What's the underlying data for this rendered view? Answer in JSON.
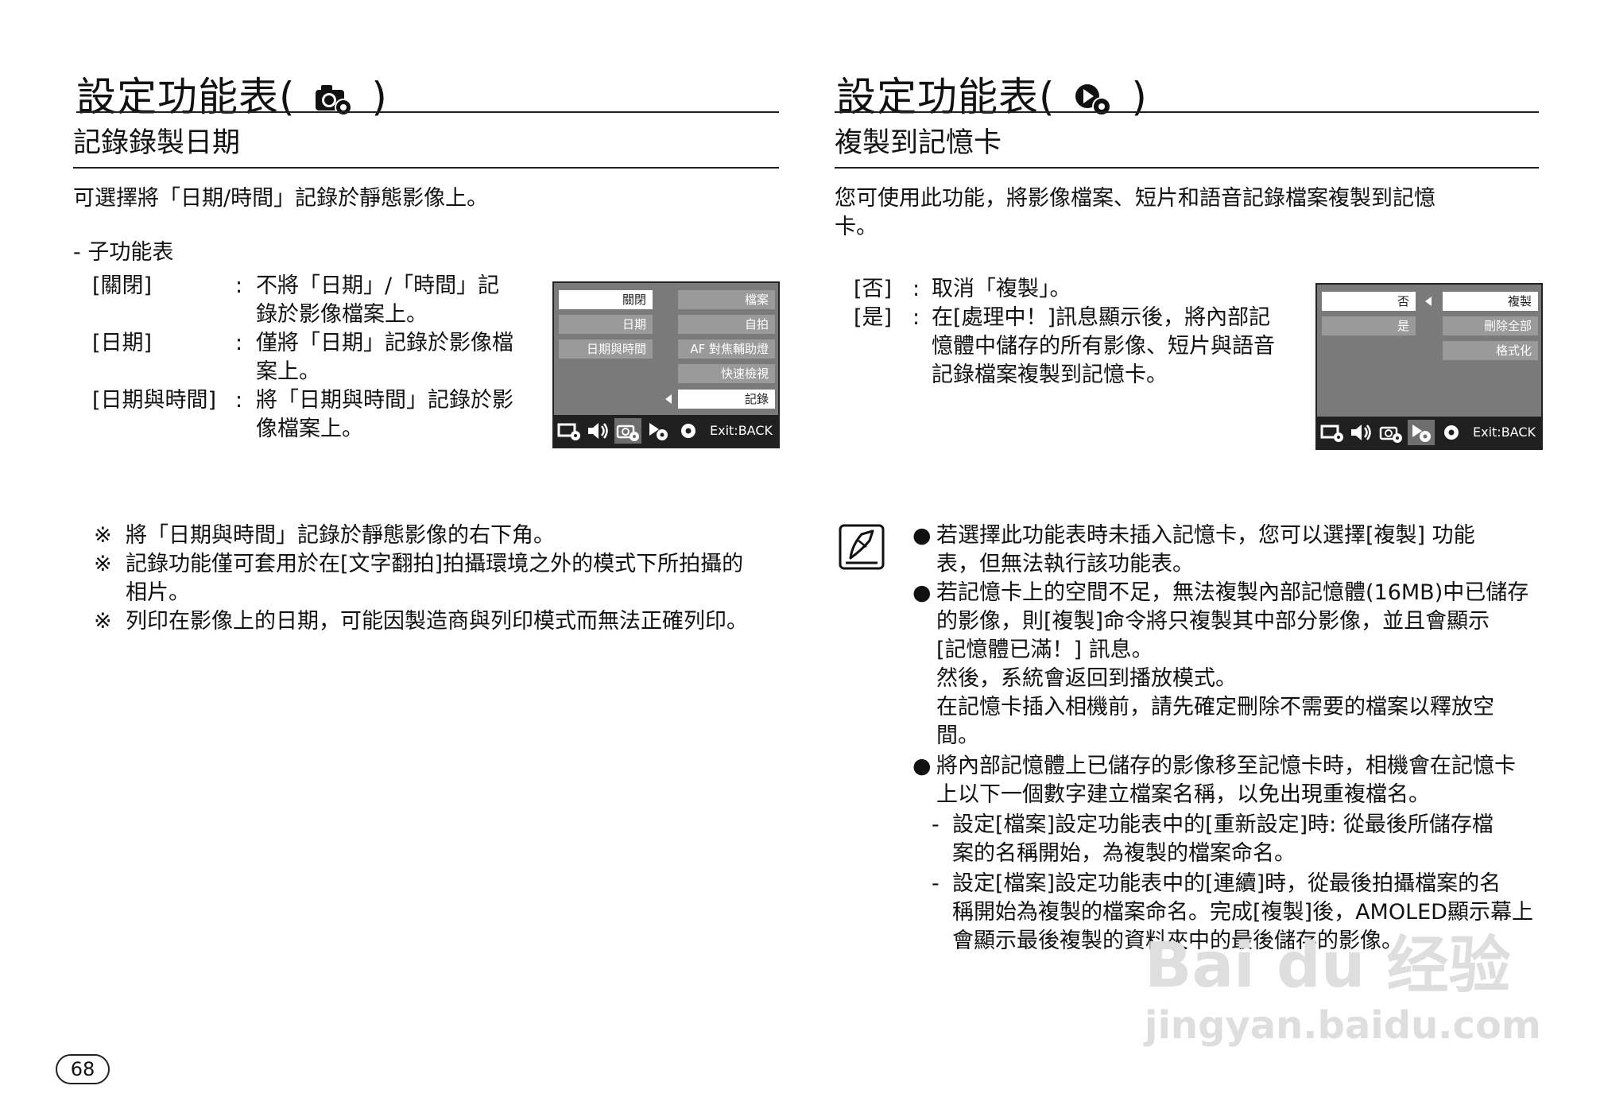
{
  "left": {
    "title_prefix": "設定功能表(",
    "title_suffix": ")",
    "title_icon": "camera-gear-icon",
    "subtitle": "記錄錄製日期",
    "intro": "可選擇將「日期/時間」記錄於靜態影像上。",
    "submenu_heading": "- 子功能表",
    "options": [
      {
        "key": "[關閉]",
        "sep": ":",
        "lines": [
          "不將「日期」/「時間」記",
          "錄於影像檔案上。"
        ]
      },
      {
        "key": "[日期]",
        "sep": ":",
        "lines": [
          "僅將「日期」記錄於影像檔",
          "案上。"
        ]
      },
      {
        "key": "[日期與時間]",
        "sep": ":",
        "lines": [
          "將「日期與時間」記錄於影",
          "像檔案上。"
        ]
      }
    ],
    "screen": {
      "left_items": [
        "關閉",
        "日期",
        "日期與時間"
      ],
      "right_items": [
        "檔案",
        "自拍",
        "AF 對焦輔助燈",
        "快速檢視",
        "記錄"
      ],
      "exit": "Exit:BACK"
    },
    "notes": [
      {
        "mark": "※",
        "lines": [
          "將「日期與時間」記錄於靜態影像的右下角。"
        ]
      },
      {
        "mark": "※",
        "lines": [
          "記錄功能僅可套用於在[文字翻拍]拍攝環境之外的模式下所拍攝的",
          "相片。"
        ]
      },
      {
        "mark": "※",
        "lines": [
          "列印在影像上的日期，可能因製造商與列印模式而無法正確列印。"
        ]
      }
    ]
  },
  "right": {
    "title_prefix": "設定功能表(",
    "title_suffix": ")",
    "title_icon": "playback-gear-icon",
    "subtitle": "複製到記憶卡",
    "intro_lines": [
      "您可使用此功能，將影像檔案、短片和語音記錄檔案複製到記憶",
      "卡。"
    ],
    "options": [
      {
        "key": "[否]",
        "sep": ":",
        "lines": [
          "取消「複製」。"
        ]
      },
      {
        "key": "[是]",
        "sep": ":",
        "lines": [
          "在[處理中！]訊息顯示後，將內部記",
          "憶體中儲存的所有影像、短片與語音",
          "記錄檔案複製到記憶卡。"
        ]
      }
    ],
    "screen": {
      "left_items": [
        "否",
        "是"
      ],
      "right_items": [
        "複製",
        "刪除全部",
        "格式化"
      ],
      "exit": "Exit:BACK"
    },
    "bullets": [
      {
        "mark": "●",
        "lines": [
          "若選擇此功能表時未插入記憶卡，您可以選擇[複製] 功能",
          "表，但無法執行該功能表。"
        ]
      },
      {
        "mark": "●",
        "lines": [
          "若記憶卡上的空間不足，無法複製內部記憶體(16MB)中已儲存",
          "的影像，則[複製]命令將只複製其中部分影像，並且會顯示",
          "[記憶體已滿！] 訊息。",
          "然後，系統會返回到播放模式。",
          "在記憶卡插入相機前，請先確定刪除不需要的檔案以釋放空",
          "間。"
        ]
      },
      {
        "mark": "●",
        "lines": [
          "將內部記憶體上已儲存的影像移至記憶卡時，相機會在記憶卡",
          "上以下一個數字建立檔案名稱，以免出現重複檔名。"
        ]
      }
    ],
    "dashes": [
      {
        "mark": "-",
        "lines": [
          "設定[檔案]設定功能表中的[重新設定]時: 從最後所儲存檔",
          "案的名稱開始，為複製的檔案命名。"
        ]
      },
      {
        "mark": "-",
        "lines": [
          "設定[檔案]設定功能表中的[連續]時，從最後拍攝檔案的名",
          "稱開始為複製的檔案命名。完成[複製]後，AMOLED顯示幕上",
          "會顯示最後複製的資料夾中的最後儲存的影像。"
        ]
      }
    ]
  },
  "page_number": "68",
  "watermark": {
    "brand": "Bai du 经验",
    "url": "jingyan.baidu.com"
  }
}
